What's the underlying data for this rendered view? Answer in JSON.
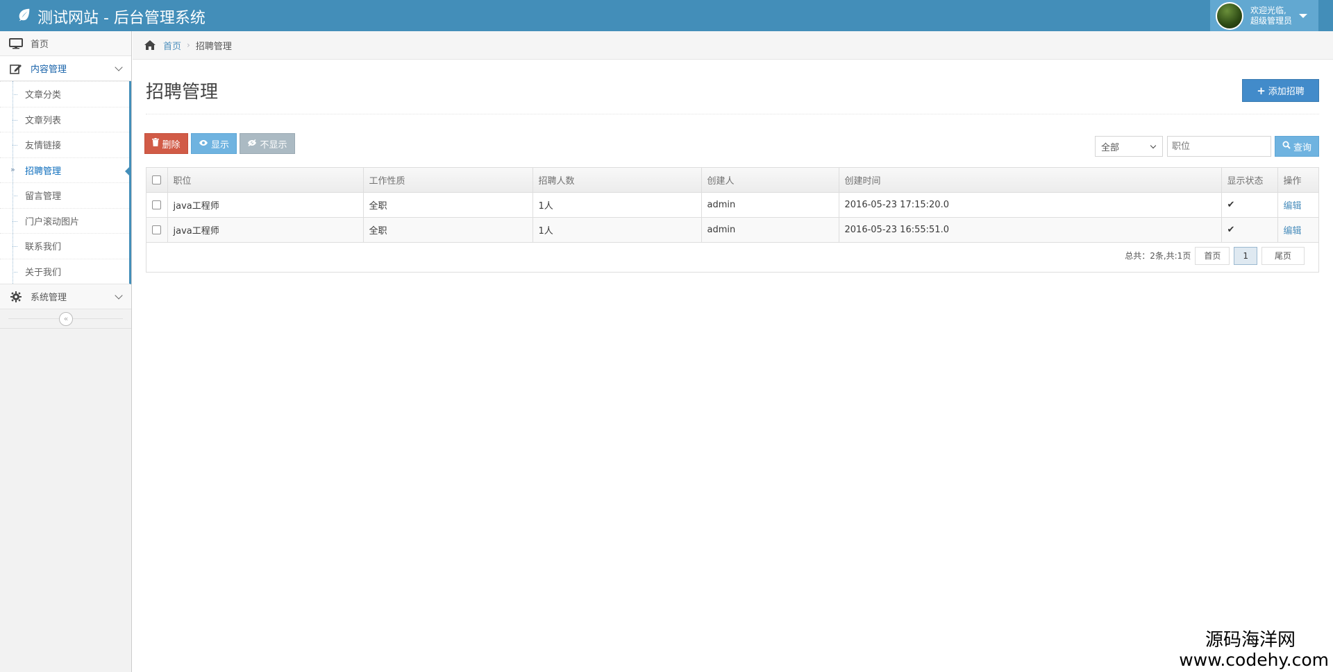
{
  "navbar": {
    "brand": "测试网站 - 后台管理系统",
    "welcome": "欢迎光临,",
    "role": "超级管理员"
  },
  "sidebar": {
    "home": "首页",
    "content_mgmt": "内容管理",
    "sub_items": [
      "文章分类",
      "文章列表",
      "友情链接",
      "招聘管理",
      "留言管理",
      "门户滚动图片",
      "联系我们",
      "关于我们"
    ],
    "active_index": 3,
    "system_mgmt": "系统管理"
  },
  "breadcrumb": {
    "home": "首页",
    "current": "招聘管理"
  },
  "page": {
    "title": "招聘管理",
    "add_button": "添加招聘"
  },
  "toolbar": {
    "delete": "删除",
    "show": "显示",
    "hide": "不显示",
    "filter_selected": "全部",
    "search_placeholder": "职位",
    "query": "查询"
  },
  "table": {
    "headers": [
      "职位",
      "工作性质",
      "招聘人数",
      "创建人",
      "创建时间",
      "显示状态",
      "操作"
    ],
    "rows": [
      {
        "position": "java工程师",
        "type": "全职",
        "count": "1人",
        "creator": "admin",
        "created": "2016-05-23 17:15:20.0",
        "shown": true,
        "action": "编辑"
      },
      {
        "position": "java工程师",
        "type": "全职",
        "count": "1人",
        "creator": "admin",
        "created": "2016-05-23 16:55:51.0",
        "shown": true,
        "action": "编辑"
      }
    ]
  },
  "pagination": {
    "summary": "总共：2条,共:1页",
    "first": "首页",
    "current": "1",
    "last": "尾页"
  },
  "watermark": {
    "line1": "源码海洋网",
    "line2": "www.codehy.com"
  },
  "colors": {
    "navbar": "#438eb9",
    "primary": "#428bca",
    "danger": "#d15b47",
    "info": "#6fb3e0",
    "grey": "#abbac3"
  }
}
